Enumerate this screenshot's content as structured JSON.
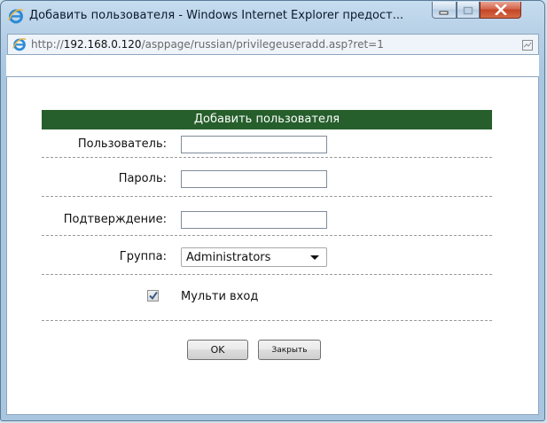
{
  "window": {
    "title": "Добавить пользователя - Windows Internet Explorer предост..."
  },
  "address": {
    "prefix": "http://",
    "host": "192.168.0.120",
    "path": "/asppage/russian/privilegeuseradd.asp?ret=1"
  },
  "form": {
    "header": "Добавить пользователя",
    "user_label": "Пользователь:",
    "user_value": "",
    "password_label": "Пароль:",
    "password_value": "",
    "confirm_label": "Подтверждение:",
    "confirm_value": "",
    "group_label": "Группа:",
    "group_selected": "Administrators",
    "multi_login_label": "Мульти вход",
    "multi_login_checked": true,
    "ok_label": "OK",
    "close_label": "Закрыть"
  },
  "colors": {
    "header_bg": "#265f2c",
    "close_button": "#c44526"
  },
  "icons": [
    "ie-icon",
    "minimize-icon",
    "maximize-icon",
    "close-icon",
    "compatibility-view-icon",
    "checkmark-icon",
    "chevron-down-icon"
  ]
}
